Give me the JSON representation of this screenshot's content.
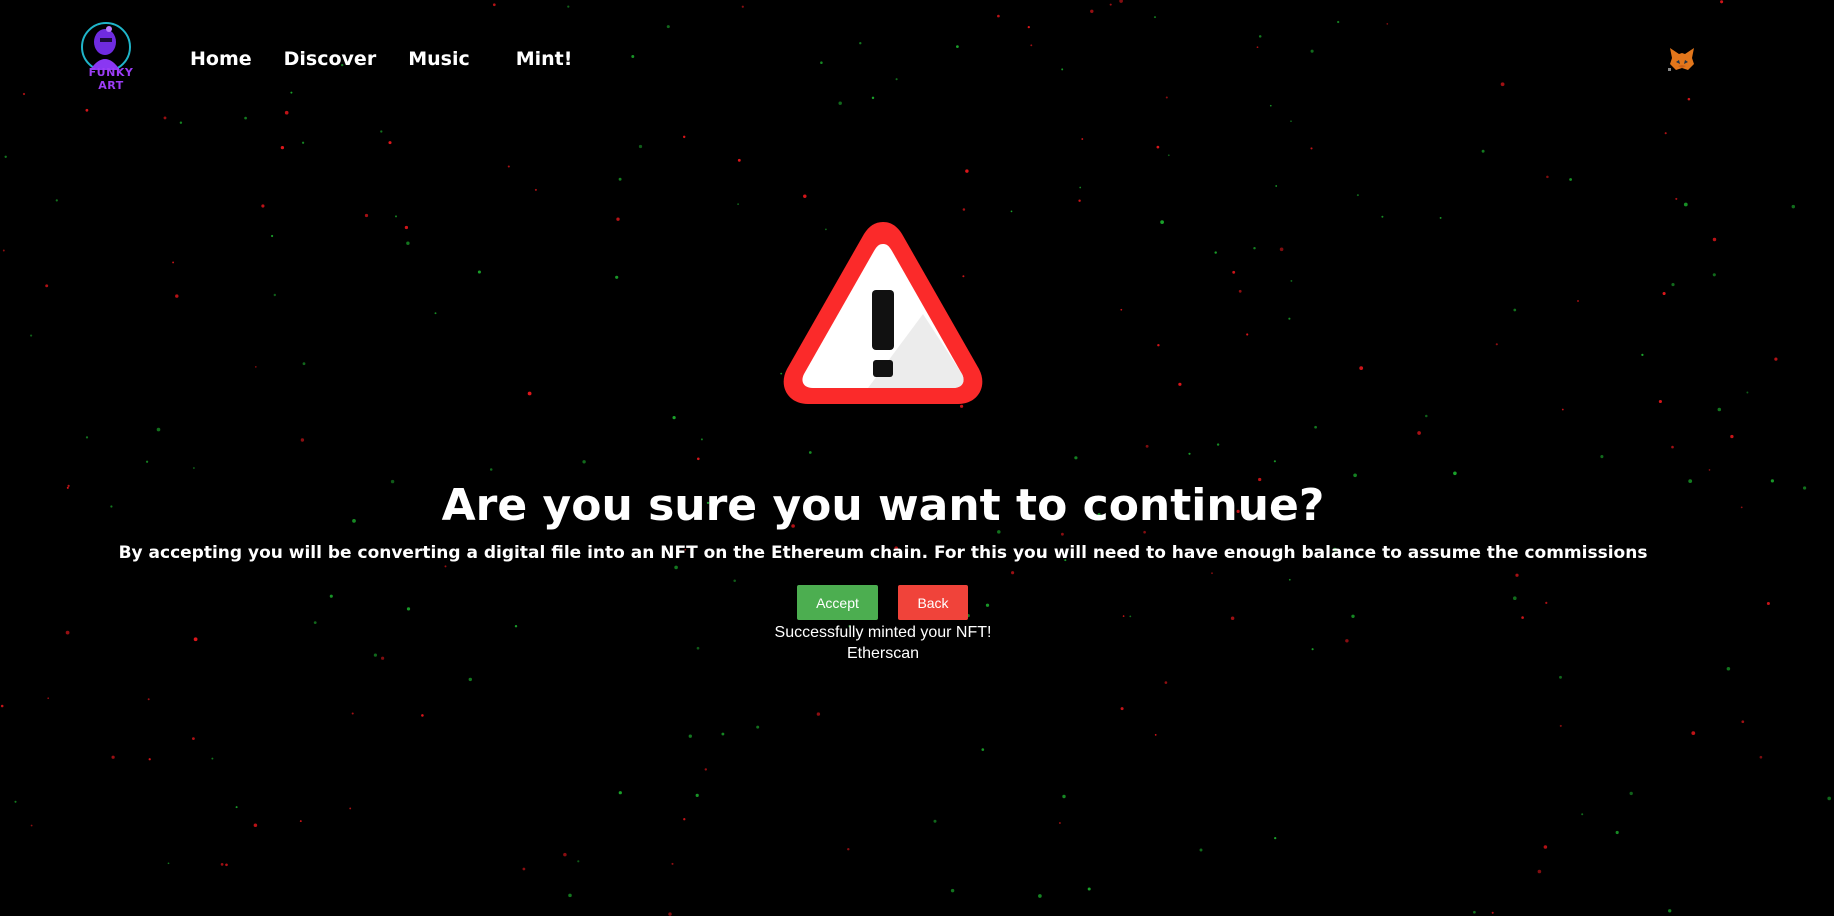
{
  "nav": {
    "logo_text": "FUNKY ART",
    "links": [
      {
        "label": "Home"
      },
      {
        "label": "Discover"
      },
      {
        "label": "Music"
      },
      {
        "label": "Mint!"
      }
    ],
    "wallet_icon": "metamask-fox-icon"
  },
  "main": {
    "warning_icon": "warning-triangle-icon",
    "heading": "Are you sure you want to continue?",
    "description": "By accepting you will be converting a digital file into an NFT on the Ethereum chain. For this you will need to have enough balance to assume the commissions",
    "accept_label": "Accept",
    "back_label": "Back",
    "status_text": "Successfully minted your NFT!",
    "etherscan_label": "Etherscan"
  },
  "colors": {
    "background": "#000000",
    "accept": "#4cae50",
    "back": "#f0433a",
    "warning_red": "#fb2a2a",
    "star_red": "#e0161b",
    "star_green": "#1aa32a"
  }
}
